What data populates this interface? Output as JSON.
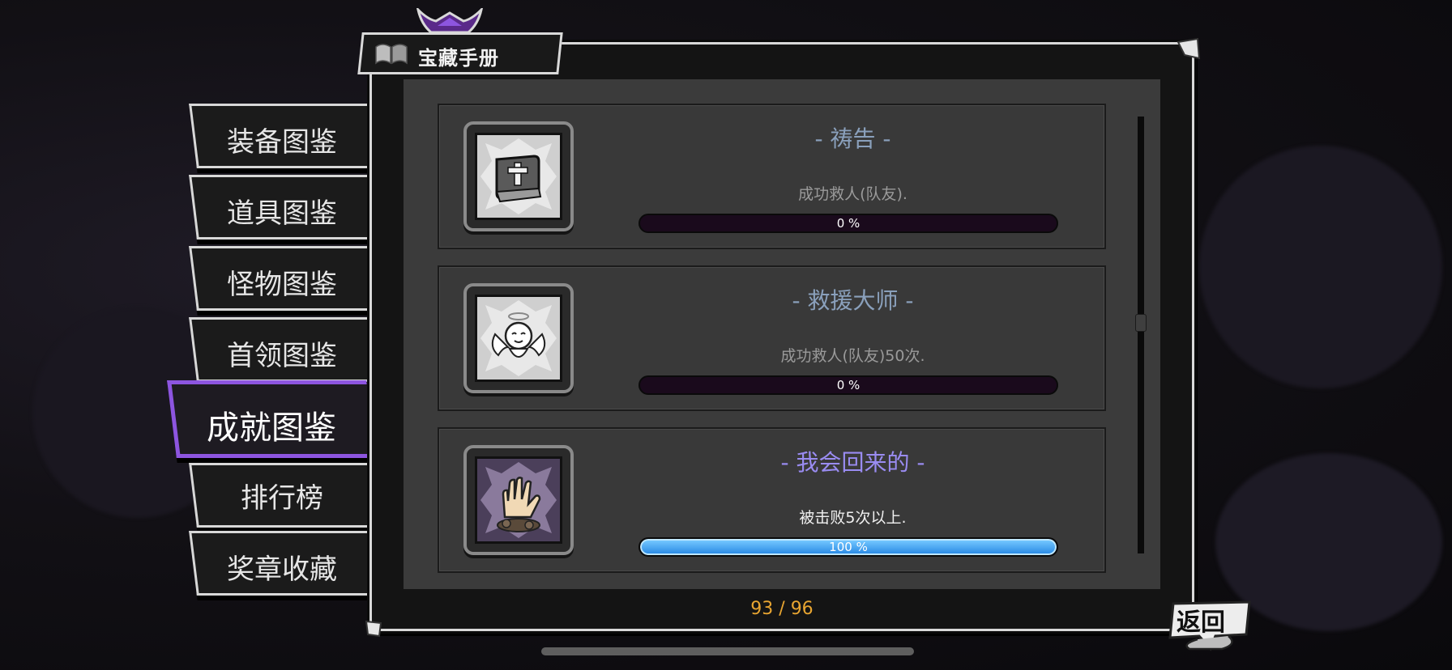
{
  "window": {
    "title": "宝藏手册"
  },
  "sidebar": {
    "items": [
      {
        "label": "装备图鉴",
        "active": false
      },
      {
        "label": "道具图鉴",
        "active": false
      },
      {
        "label": "怪物图鉴",
        "active": false
      },
      {
        "label": "首领图鉴",
        "active": false
      },
      {
        "label": "成就图鉴",
        "active": true
      },
      {
        "label": "排行榜",
        "active": false
      },
      {
        "label": "奖章收藏",
        "active": false
      }
    ]
  },
  "achievements": [
    {
      "title": "- 祷告 -",
      "desc": "成功救人(队友).",
      "progress_text": "0 %",
      "progress": 0,
      "icon": "bible-icon",
      "title_color": "#8aa0bc",
      "desc_color": "#9a9a9a"
    },
    {
      "title": "- 救援大师 -",
      "desc": "成功救人(队友)50次.",
      "progress_text": "0 %",
      "progress": 0,
      "icon": "angel-icon",
      "title_color": "#8aa0bc",
      "desc_color": "#9a9a9a"
    },
    {
      "title": "- 我会回来的 -",
      "desc": "被击败5次以上.",
      "progress_text": "100 %",
      "progress": 1,
      "icon": "rising-hand-icon",
      "title_color": "#9a8cf2",
      "desc_color": "#f0f0f0"
    }
  ],
  "footer": {
    "counter": "93 / 96"
  },
  "back_button": {
    "label": "返回"
  },
  "colors": {
    "accent": "#8d55e0",
    "counter": "#e8a531",
    "progress_fill": "#3a9cf0"
  }
}
